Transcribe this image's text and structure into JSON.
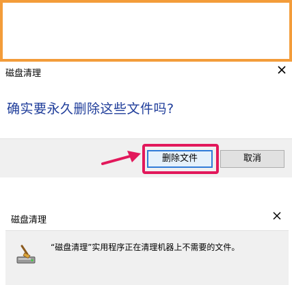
{
  "dialog1": {
    "title": "磁盘清理",
    "question": "确实要永久删除这些文件吗?",
    "delete_button": "删除文件",
    "cancel_button": "取消"
  },
  "dialog2": {
    "title": "磁盘清理",
    "message": "“磁盘清理”实用程序正在清理机器上不需要的文件。"
  },
  "colors": {
    "frame": "#f39c3a",
    "highlight": "#e2185b",
    "question_text": "#1f3d9a"
  },
  "icons": [
    "close-icon",
    "pointer-arrow-icon",
    "disk-cleanup-icon"
  ]
}
